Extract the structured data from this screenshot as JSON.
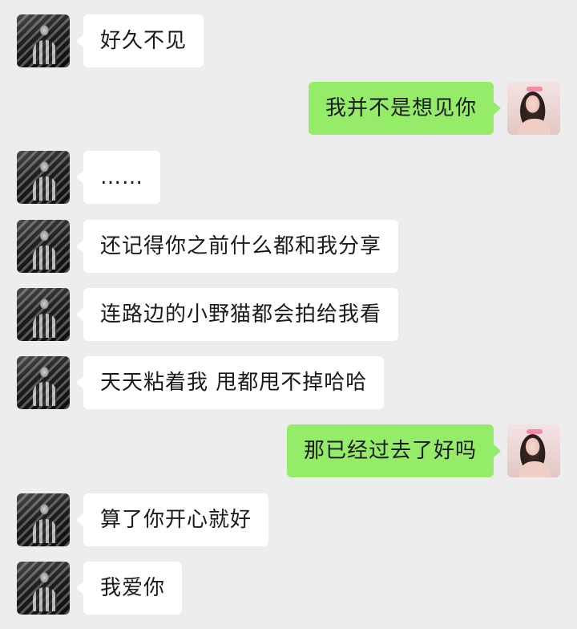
{
  "theme": {
    "background": "#ededed",
    "incoming_bubble": "#ffffff",
    "outgoing_bubble": "#95ec69"
  },
  "messages": [
    {
      "sender": "other",
      "avatar": "dark-photo-avatar",
      "text": "好久不见"
    },
    {
      "sender": "me",
      "avatar": "girl-photo-avatar",
      "text": "我并不是想见你"
    },
    {
      "sender": "other",
      "avatar": "dark-photo-avatar",
      "text": "……"
    },
    {
      "sender": "other",
      "avatar": "dark-photo-avatar",
      "text": "还记得你之前什么都和我分享"
    },
    {
      "sender": "other",
      "avatar": "dark-photo-avatar",
      "text": "连路边的小野猫都会拍给我看"
    },
    {
      "sender": "other",
      "avatar": "dark-photo-avatar",
      "text": "天天粘着我 甩都甩不掉哈哈"
    },
    {
      "sender": "me",
      "avatar": "girl-photo-avatar",
      "text": "那已经过去了好吗"
    },
    {
      "sender": "other",
      "avatar": "dark-photo-avatar",
      "text": "算了你开心就好"
    },
    {
      "sender": "other",
      "avatar": "dark-photo-avatar",
      "text": "我爱你"
    }
  ]
}
